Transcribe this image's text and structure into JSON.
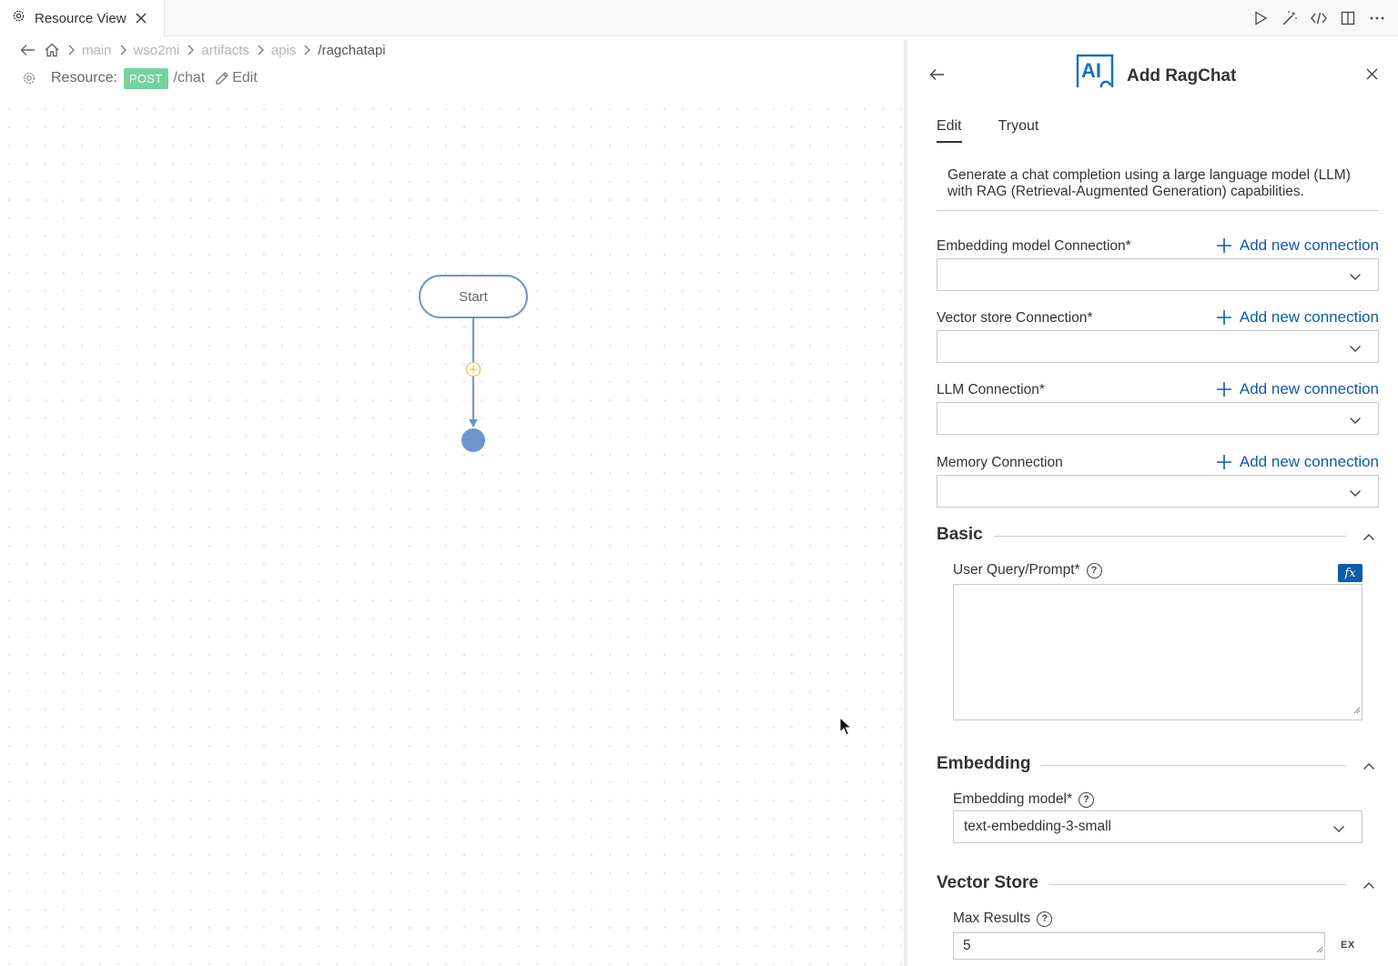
{
  "tab": {
    "title": "Resource View"
  },
  "breadcrumb": [
    "main",
    "wso2mi",
    "artifacts",
    "apis",
    "/ragchatapi"
  ],
  "resource": {
    "label": "Resource:",
    "method": "POST",
    "path": "/chat",
    "edit_label": "Edit"
  },
  "diagram": {
    "start_label": "Start"
  },
  "panel": {
    "title": "Add RagChat",
    "logo_text": "AI",
    "tabs": [
      "Edit",
      "Tryout"
    ],
    "active_tab": "Edit",
    "description": "Generate a chat completion using a large language model (LLM) with RAG (Retrieval-Augmented Generation) capabilities.",
    "add_connection_label": "Add new connection",
    "connections": [
      {
        "label": "Embedding model Connection*",
        "value": ""
      },
      {
        "label": "Vector store Connection*",
        "value": ""
      },
      {
        "label": "LLM Connection*",
        "value": ""
      },
      {
        "label": "Memory Connection",
        "value": ""
      }
    ],
    "basic": {
      "title": "Basic",
      "prompt_label": "User Query/Prompt*",
      "fx_label": "fx",
      "prompt_value": ""
    },
    "embedding": {
      "title": "Embedding",
      "model_label": "Embedding model*",
      "model_value": "text-embedding-3-small"
    },
    "vector_store": {
      "title": "Vector Store",
      "max_results_label": "Max Results",
      "max_results_value": "5",
      "ex_label": "EX"
    }
  },
  "colors": {
    "accent": "#0d5bab",
    "node": "#6d96cc",
    "post_badge": "#73d3a0"
  }
}
